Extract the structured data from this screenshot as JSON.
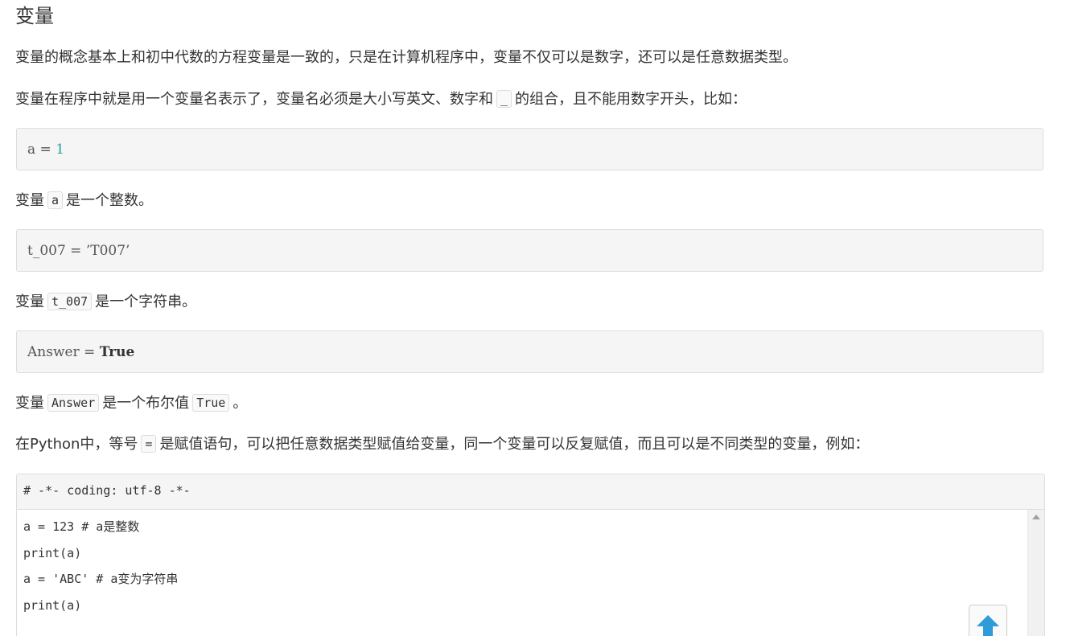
{
  "section_title": "变量",
  "paragraphs": {
    "p1": "变量的概念基本上和初中代数的方程变量是一致的，只是在计算机程序中，变量不仅可以是数字，还可以是任意数据类型。",
    "p2_before": "变量在程序中就是用一个变量名表示了，变量名必须是大小写英文、数字和",
    "p2_code": "_",
    "p2_after": "的组合，且不能用数字开头，比如：",
    "p3_before": "变量",
    "p3_code": "a",
    "p3_after": "是一个整数。",
    "p4_before": "变量",
    "p4_code": "t_007",
    "p4_after": "是一个字符串。",
    "p5_before": "变量",
    "p5_code": "Answer",
    "p5_mid": "是一个布尔值",
    "p5_code2": "True",
    "p5_after": "。",
    "p6_before": "在Python中，等号",
    "p6_code": "=",
    "p6_after": "是赋值语句，可以把任意数据类型赋值给变量，同一个变量可以反复赋值，而且可以是不同类型的变量，例如："
  },
  "code_blocks": {
    "block1": {
      "lhs": "a = ",
      "value": "1"
    },
    "block2": {
      "text": "t_007 = ’T007’"
    },
    "block3": {
      "lhs": "Answer = ",
      "value": "True"
    }
  },
  "editor": {
    "header": "# -*- coding: utf-8 -*-",
    "lines": [
      "a = 123 # a是整数",
      "print(a)",
      "a = 'ABC' # a变为字符串",
      "print(a)"
    ]
  },
  "icons": {
    "back_to_top": "arrow-up-icon",
    "scroll_up": "scroll-up-arrow-icon"
  },
  "colors": {
    "number": "#2a9d9d",
    "back_to_top_arrow": "#2f9bd8"
  }
}
